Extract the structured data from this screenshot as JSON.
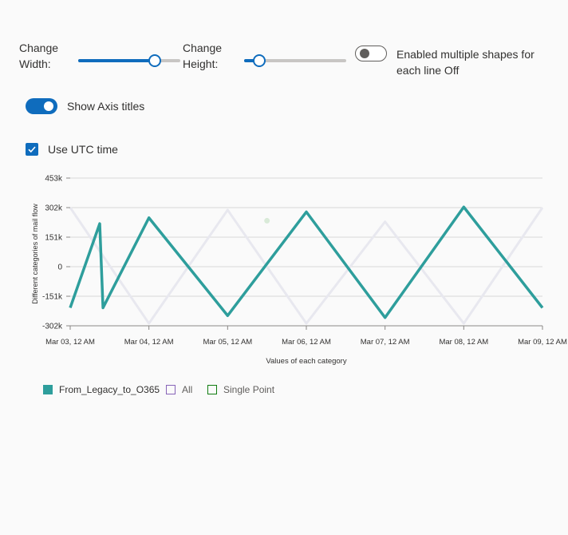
{
  "controls": {
    "width_label": "Change Width:",
    "width_value_fraction": 0.75,
    "height_label": "Change Height:",
    "height_value_fraction": 0.15,
    "multi_shapes_label": "Enabled multiple shapes for each line Off",
    "multi_shapes_on": false,
    "axis_titles_label": "Show Axis titles",
    "axis_titles_on": true,
    "utc_label": "Use UTC time",
    "utc_checked": true
  },
  "colors": {
    "accent": "#0f6cbd",
    "series_main": "#2e9e9c",
    "series_all": "#8764b8",
    "series_single": "#107c10",
    "faded": "#e8e8ef"
  },
  "chart_data": {
    "type": "line",
    "xlabel": "Values of each category",
    "ylabel": "Different categories of mail flow",
    "xlim": [
      "2024-03-03T00:00",
      "2024-03-09T00:00"
    ],
    "ylim": [
      -302000,
      453000
    ],
    "y_ticks": [
      "453k",
      "302k",
      "151k",
      "0",
      "-151k",
      "-302k"
    ],
    "x_ticks": [
      "Mar 03, 12 AM",
      "Mar 04, 12 AM",
      "Mar 05, 12 AM",
      "Mar 06, 12 AM",
      "Mar 07, 12 AM",
      "Mar 08, 12 AM",
      "Mar 09, 12 AM"
    ],
    "grid": true,
    "legend_position": "bottom-left",
    "series": [
      {
        "name": "From_Legacy_to_O365",
        "x": [
          "2024-03-03T00:00",
          "2024-03-03T09:00",
          "2024-03-03T10:00",
          "2024-03-04T00:00",
          "2024-03-05T00:00",
          "2024-03-06T00:00",
          "2024-03-07T00:00",
          "2024-03-08T00:00",
          "2024-03-09T00:00"
        ],
        "y": [
          -210000,
          220000,
          -210000,
          250000,
          -250000,
          280000,
          -260000,
          305000,
          -210000
        ]
      },
      {
        "name": "All",
        "x": [
          "2024-03-03T00:00",
          "2024-03-04T00:00",
          "2024-03-05T00:00",
          "2024-03-06T00:00",
          "2024-03-07T00:00",
          "2024-03-08T00:00",
          "2024-03-09T00:00"
        ],
        "y": [
          302000,
          -290000,
          290000,
          -290000,
          230000,
          -290000,
          302000
        ]
      },
      {
        "name": "Single Point",
        "x": [
          "2024-03-05T12:00"
        ],
        "y": [
          235000
        ]
      }
    ]
  }
}
